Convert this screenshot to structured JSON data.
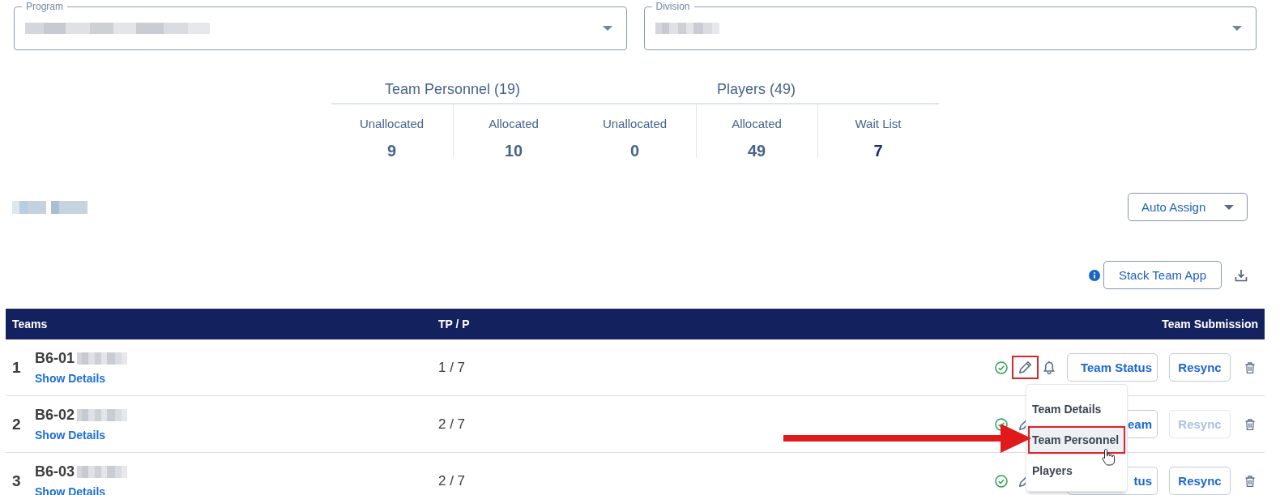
{
  "filters": [
    {
      "label": "Program",
      "redacted": true
    },
    {
      "label": "Division",
      "redacted": true
    }
  ],
  "summary": {
    "groups": [
      {
        "title": "Team Personnel (19)",
        "stats": [
          {
            "label": "Unallocated",
            "value": "9",
            "highlighted": false
          },
          {
            "label": "Allocated",
            "value": "10",
            "highlighted": false
          }
        ]
      },
      {
        "title": "Players (49)",
        "stats": [
          {
            "label": "Unallocated",
            "value": "0",
            "highlighted": false
          },
          {
            "label": "Allocated",
            "value": "49",
            "highlighted": false
          },
          {
            "label": "Wait List",
            "value": "7",
            "highlighted": true
          }
        ]
      }
    ]
  },
  "section": {
    "title_redacted": true,
    "auto_assign_button": "Auto Assign"
  },
  "toolbar": {
    "stack_team_app_button": "Stack Team App"
  },
  "table": {
    "columns": [
      "Teams",
      "TP / P",
      "Team Submission"
    ],
    "rows": [
      {
        "number": "1",
        "name": "B6-01",
        "name_redacted": true,
        "details_link": "Show Details",
        "tp_p": "1 / 7",
        "submitted": true,
        "bell": true,
        "edit_marked": true,
        "status_button": "Team Status",
        "resync": {
          "label": "Resync",
          "disabled": false
        },
        "edit_menu": {
          "items": [
            {
              "label": "Team Details",
              "selected": false
            },
            {
              "label": "Team Personnel",
              "selected": true
            },
            {
              "label": "Players",
              "selected": false
            }
          ]
        }
      },
      {
        "number": "2",
        "name": "B6-02",
        "name_redacted": true,
        "details_link": "Show Details",
        "tp_p": "2 / 7",
        "submitted": true,
        "bell": false,
        "edit_marked": false,
        "status_button": "eam",
        "resync": {
          "label": "Resync",
          "disabled": true
        }
      },
      {
        "number": "3",
        "name": "B6-03",
        "name_redacted": true,
        "details_link": "Show Details",
        "tp_p": "2 / 7",
        "submitted": true,
        "bell": false,
        "edit_marked": false,
        "status_button": "tus",
        "resync": {
          "label": "Resync",
          "disabled": false
        }
      }
    ]
  }
}
